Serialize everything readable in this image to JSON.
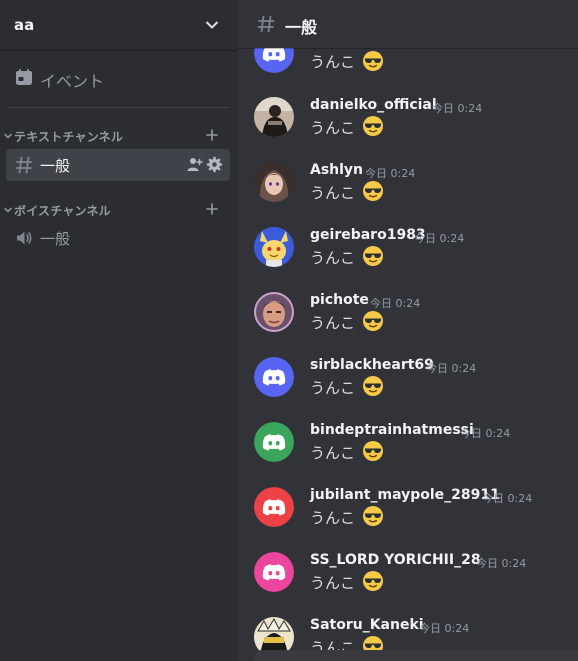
{
  "server": {
    "name": "aa"
  },
  "sidebar": {
    "events_label": "イベント",
    "categories": [
      {
        "label": "テキストチャンネル",
        "channels": [
          {
            "label": "一般",
            "type": "text",
            "selected": true
          }
        ]
      },
      {
        "label": "ボイスチャンネル",
        "channels": [
          {
            "label": "一般",
            "type": "voice",
            "selected": false
          }
        ]
      }
    ]
  },
  "channel": {
    "title": "一般"
  },
  "messages": [
    {
      "username": "",
      "timestamp": "",
      "text": "うんこ",
      "avatar": "discord-logo",
      "avatar_color": "#5865f2"
    },
    {
      "username": "danielko_official",
      "timestamp": "今日 0:24",
      "text": "うんこ",
      "avatar": "photo-dark-figure",
      "avatar_color": "#b8a89a"
    },
    {
      "username": "Ashlyn",
      "timestamp": "今日 0:24",
      "text": "うんこ",
      "avatar": "anime-girl",
      "avatar_color": "#4a3d3a"
    },
    {
      "username": "geirebaro1983",
      "timestamp": "今日 0:24",
      "text": "うんこ",
      "avatar": "yellow-character",
      "avatar_color": "#4169e1"
    },
    {
      "username": "pichote",
      "timestamp": "今日 0:24",
      "text": "うんこ",
      "avatar": "face-photo",
      "avatar_color": "#c9a2c9"
    },
    {
      "username": "sirblackheart69",
      "timestamp": "今日 0:24",
      "text": "うんこ",
      "avatar": "discord-logo",
      "avatar_color": "#5865f2"
    },
    {
      "username": "bindeptrainhatmessi",
      "timestamp": "今日 0:24",
      "text": "うんこ",
      "avatar": "discord-logo",
      "avatar_color": "#3ba55c"
    },
    {
      "username": "jubilant_maypole_28911",
      "timestamp": "今日 0:24",
      "text": "うんこ",
      "avatar": "discord-logo",
      "avatar_color": "#ed4245"
    },
    {
      "username": "SS_LORD YORICHII_28",
      "timestamp": "今日 0:24",
      "text": "うんこ",
      "avatar": "discord-logo",
      "avatar_color": "#eb459e"
    },
    {
      "username": "Satoru_Kaneki",
      "timestamp": "今日 0:24",
      "text": "うんこ",
      "avatar": "manga-character",
      "avatar_color": "#e8e0c8"
    }
  ],
  "colors": {
    "sidebar_bg": "#2b2d31",
    "main_bg": "#313338",
    "selected_channel_bg": "#404249",
    "muted_text": "#949ba4",
    "bright_text": "#f2f3f5"
  },
  "icons": {
    "emoji": "sunglasses-emoji",
    "events": "calendar-icon",
    "text_channel": "hash-icon",
    "voice_channel": "speaker-icon",
    "invite": "add-member-icon",
    "settings": "gear-icon",
    "server_menu": "chevron-down-icon"
  }
}
